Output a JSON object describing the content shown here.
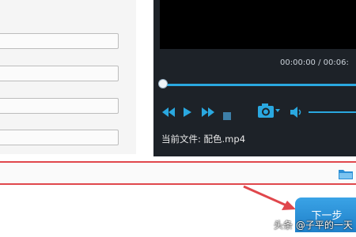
{
  "player": {
    "time_readout": "00:00:00 / 00:06:",
    "current_file_label": "当前文件:",
    "current_file_name": "配色.mp4"
  },
  "actions": {
    "next_label": "下一步"
  },
  "watermark": {
    "text": "头条 @子平的一天"
  },
  "colors": {
    "accent": "#2aa8e0",
    "highlight_border": "#e0474c",
    "player_bg": "#1d2228",
    "button_blue": "#2b8fd6"
  },
  "icons": [
    "rewind-icon",
    "play-icon",
    "fast-forward-icon",
    "stop-icon",
    "camera-icon",
    "volume-icon",
    "folder-icon",
    "red-arrow-icon"
  ]
}
